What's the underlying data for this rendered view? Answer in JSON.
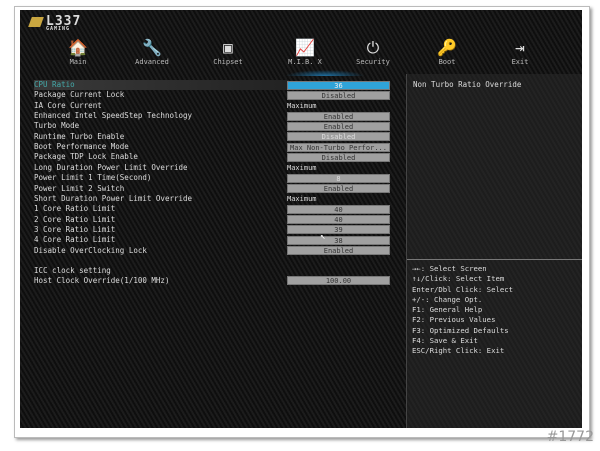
{
  "logo": {
    "name": "L337",
    "sub": "GAMING"
  },
  "tabs": [
    {
      "label": "Main",
      "icon": "🏠"
    },
    {
      "label": "Advanced",
      "icon": "🔧"
    },
    {
      "label": "Chipset",
      "icon": "▣"
    },
    {
      "label": "M.I.B. X",
      "icon": "📈"
    },
    {
      "label": "Security",
      "icon": "⏻"
    },
    {
      "label": "Boot",
      "icon": "🔑"
    },
    {
      "label": "Exit",
      "icon": "⇥"
    }
  ],
  "active_tab": "M.I.B. X",
  "settings": [
    {
      "label": "CPU Ratio",
      "value": "36",
      "type": "box"
    },
    {
      "label": "Package Current Lock",
      "value": "Disabled",
      "type": "box"
    },
    {
      "label": "IA Core Current",
      "value": "Maximum",
      "type": "plain"
    },
    {
      "label": "Enhanced Intel SpeedStep Technology",
      "value": "Enabled",
      "type": "box"
    },
    {
      "label": "Turbo Mode",
      "value": "Enabled",
      "type": "box"
    },
    {
      "label": "Runtime Turbo Enable",
      "value": "Disabled",
      "type": "box"
    },
    {
      "label": "Boot Performance Mode",
      "value": "Max Non-Turbo Perfor...",
      "type": "box"
    },
    {
      "label": "Package TDP Lock Enable",
      "value": "Disabled",
      "type": "box"
    },
    {
      "label": "Long Duration Power Limit Override",
      "value": "Maximum",
      "type": "plain"
    },
    {
      "label": "Power Limit 1 Time(Second)",
      "value": "8",
      "type": "box"
    },
    {
      "label": "Power Limit 2 Switch",
      "value": "Enabled",
      "type": "box"
    },
    {
      "label": "Short Duration Power Limit Override",
      "value": "Maximum",
      "type": "plain"
    },
    {
      "label": "1 Core Ratio Limit",
      "value": "40",
      "type": "box"
    },
    {
      "label": "2 Core Ratio Limit",
      "value": "40",
      "type": "box"
    },
    {
      "label": "3 Core Ratio Limit",
      "value": "39",
      "type": "box"
    },
    {
      "label": "4 Core Ratio Limit",
      "value": "38",
      "type": "box"
    },
    {
      "label": "Disable OverClocking Lock",
      "value": "Enabled",
      "type": "box"
    }
  ],
  "icc": {
    "heading": "ICC clock setting",
    "label": "Host Clock Override(1/100 MHz)",
    "value": "100.00"
  },
  "help_text": "Non Turbo Ratio Override",
  "keys": [
    "→←: Select Screen",
    "↑↓/Click: Select Item",
    "Enter/Dbl Click: Select",
    "+/-: Change Opt.",
    "F1: General Help",
    "F2: Previous Values",
    "F3: Optimized Defaults",
    "F4: Save & Exit",
    "ESC/Right Click: Exit"
  ],
  "watermark": "#1772"
}
